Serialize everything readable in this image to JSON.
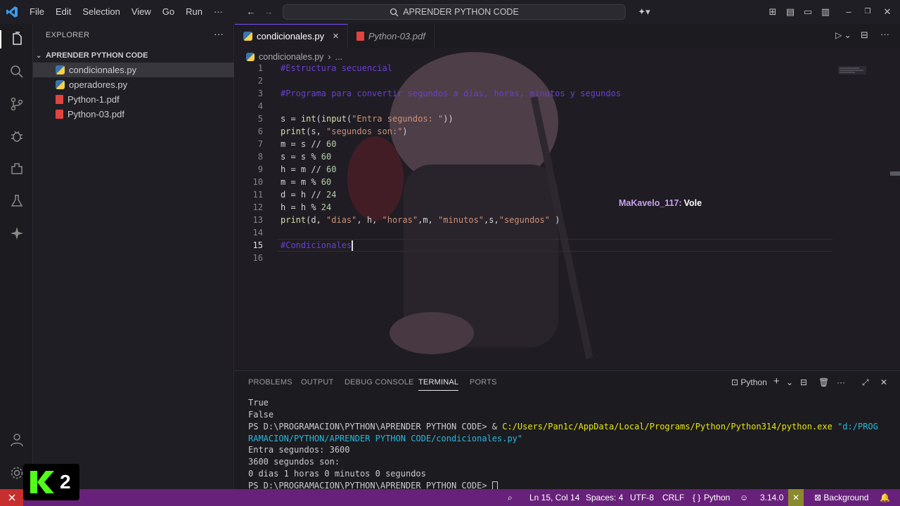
{
  "titlebar": {
    "menu": [
      "File",
      "Edit",
      "Selection",
      "View",
      "Go",
      "Run",
      "···"
    ],
    "search_text": "APRENDER PYTHON CODE"
  },
  "sidebar": {
    "title": "EXPLORER",
    "more": "···",
    "folder": "APRENDER PYTHON CODE",
    "files": [
      {
        "name": "condicionales.py",
        "type": "python",
        "active": true
      },
      {
        "name": "operadores.py",
        "type": "python",
        "active": false
      },
      {
        "name": "Python-1.pdf",
        "type": "pdf",
        "active": false
      },
      {
        "name": "Python-03.pdf",
        "type": "pdf",
        "active": false
      }
    ]
  },
  "editor": {
    "tabs": [
      {
        "label": "condicionales.py",
        "close": "×"
      },
      {
        "label": "Python-03.pdf"
      }
    ],
    "breadcrumb": {
      "file": "condicionales.py",
      "more": "..."
    },
    "line_numbers": [
      "1",
      "2",
      "3",
      "4",
      "5",
      "6",
      "7",
      "8",
      "9",
      "10",
      "11",
      "12",
      "13",
      "14",
      "15",
      "16"
    ],
    "lines": {
      "l1": "#Estructura secuencial",
      "l3": "#Programa para convertir segundos a días, horas, minutos y segundos",
      "l5a": "s = ",
      "l5b": "int",
      "l5c": "(",
      "l5d": "input",
      "l5e": "(",
      "l5f": "\"Entra segundos: \"",
      "l5g": "))",
      "l6a": "print",
      "l6b": "(s, ",
      "l6c": "\"segundos son:\"",
      "l6d": ")",
      "l7a": "m = s // ",
      "l7b": "60",
      "l8a": "s = s % ",
      "l8b": "60",
      "l9a": "h = m // ",
      "l9b": "60",
      "l10a": "m = m % ",
      "l10b": "60",
      "l11a": "d = h // ",
      "l11b": "24",
      "l12a": "h = h % ",
      "l12b": "24",
      "l13a": "print",
      "l13b": "(d, ",
      "l13c": "\"dias\"",
      "l13d": ", h, ",
      "l13e": "\"horas\"",
      "l13f": ",m, ",
      "l13g": "\"minutos\"",
      "l13h": ",s,",
      "l13i": "\"segundos\"",
      "l13j": " )",
      "l15": "#Condicionales"
    },
    "collaborator": {
      "name": "MaKavelo_117:",
      "text": "Vole"
    }
  },
  "panel": {
    "tabs": [
      "PROBLEMS",
      "OUTPUT",
      "DEBUG CONSOLE",
      "TERMINAL",
      "PORTS"
    ],
    "active_tab": "TERMINAL",
    "terminal_name": "Python",
    "terminal": {
      "t1": "True",
      "t2": "False",
      "t3a": "PS D:\\PROGRAMACION\\PYTHON\\APRENDER PYTHON CODE> ",
      "t3b": "& ",
      "t3c": "C:/Users/Pan1c/AppData/Local/Programs/Python/Python314/python.exe",
      "t3d": " \"d:/PROG",
      "t4": "RAMACION/PYTHON/APRENDER PYTHON CODE/condicionales.py\"",
      "t5": "Entra segundos: 3600",
      "t6": "3600 segundos son:",
      "t7": "0 dias 1 horas 0 minutos 0 segundos",
      "t8": "PS D:\\PROGRAMACION\\PYTHON\\APRENDER PYTHON CODE> "
    }
  },
  "statusbar": {
    "position": "Ln 15, Col 14",
    "spaces": "Spaces: 4",
    "encoding": "UTF-8",
    "eol": "CRLF",
    "language": "Python",
    "language_prefix": "{ }",
    "version": "3.14.0",
    "background": "Background"
  },
  "badge": {
    "text": "2"
  },
  "colors": {
    "accent": "#68217a",
    "remote": "#c72e2e",
    "comment": "#6a3fd0",
    "string": "#ce9178"
  }
}
